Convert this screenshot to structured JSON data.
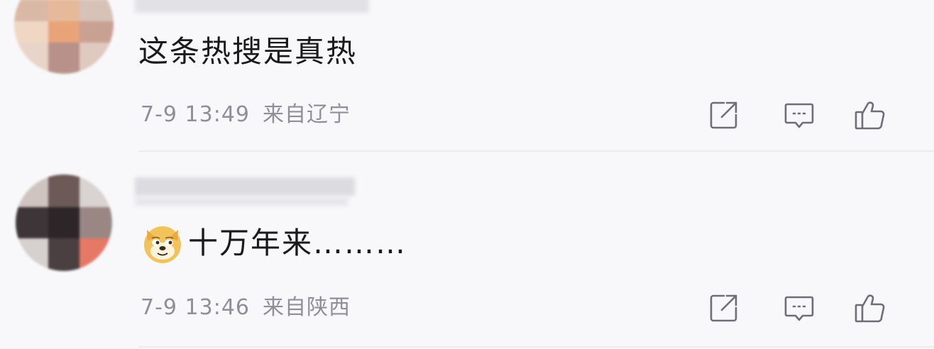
{
  "comments": [
    {
      "text": "这条热搜是真热",
      "time": "7-9 13:49",
      "location": "来自辽宁",
      "actions": [
        "share-icon",
        "reply-icon",
        "like-icon"
      ]
    },
    {
      "emoji": "doge-emoji",
      "text": "十万年来………",
      "time": "7-9 13:46",
      "location": "来自陕西",
      "actions": [
        "share-icon",
        "reply-icon",
        "like-icon"
      ]
    }
  ],
  "colors": {
    "text": "#1a1a1a",
    "meta": "#8f8f99",
    "icon": "#6e6e78",
    "background": "#f8f8fa",
    "divider": "#ececf0"
  }
}
